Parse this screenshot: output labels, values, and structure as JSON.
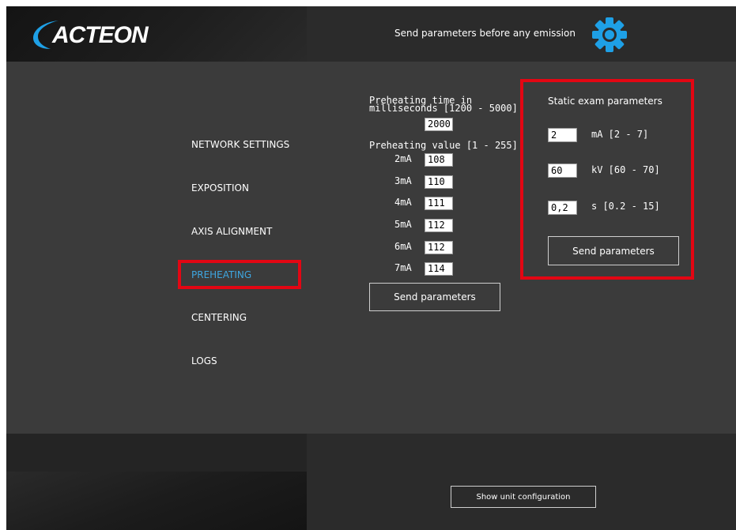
{
  "header": {
    "logo_text": "ACTEON",
    "message": "Send parameters before any emission",
    "settings_icon": "gear-icon",
    "accent_color": "#1ea0e6"
  },
  "menu": {
    "items": [
      {
        "label": "NETWORK SETTINGS",
        "active": false
      },
      {
        "label": "EXPOSITION",
        "active": false
      },
      {
        "label": "AXIS ALIGNMENT",
        "active": false
      },
      {
        "label": "PREHEATING",
        "active": true
      },
      {
        "label": "CENTERING",
        "active": false
      },
      {
        "label": "LOGS",
        "active": false
      }
    ],
    "active_color": "#3ea6e0"
  },
  "preheating": {
    "time_label_line1": "Preheating time in",
    "time_label_line2": "milliseconds [1200 - 5000]",
    "time_value": "2000",
    "value_label": "Preheating value [1 - 255]",
    "rows": [
      {
        "label": "2mA",
        "value": "108"
      },
      {
        "label": "3mA",
        "value": "110"
      },
      {
        "label": "4mA",
        "value": "111"
      },
      {
        "label": "5mA",
        "value": "112"
      },
      {
        "label": "6mA",
        "value": "112"
      },
      {
        "label": "7mA",
        "value": "114"
      }
    ],
    "send_label": "Send parameters"
  },
  "static_exam": {
    "title": "Static exam parameters",
    "ma_value": "2",
    "ma_label": "mA [2 - 7]",
    "kv_value": "60",
    "kv_label": "kV [60 - 70]",
    "s_value": "0,2",
    "s_label": "s [0.2 - 15]",
    "send_label": "Send parameters"
  },
  "footer": {
    "unit_config_label": "Show unit configuration"
  },
  "highlight_color": "#e30613"
}
